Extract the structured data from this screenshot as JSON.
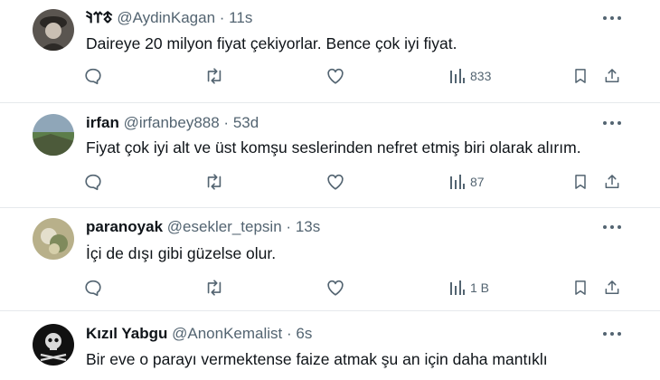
{
  "colors": {
    "text": "#0f1419",
    "muted": "#536471",
    "divider": "#e6e9ec"
  },
  "tweets": [
    {
      "name": "𐱃𐰼𐰚",
      "handle": "@AydinKagan",
      "sep": "·",
      "time": "11s",
      "text": "Daireye 20 milyon fiyat çekiyorlar. Bence çok iyi fiyat.",
      "views": "833"
    },
    {
      "name": "irfan",
      "handle": "@irfanbey888",
      "sep": "·",
      "time": "53d",
      "text": "Fiyat çok iyi alt ve üst komşu seslerinden nefret etmiş biri olarak alırım.",
      "views": "87"
    },
    {
      "name": "paranoyak",
      "handle": "@esekler_tepsin",
      "sep": "·",
      "time": "13s",
      "text": "İçi de dışı gibi güzelse olur.",
      "views": "1 B"
    },
    {
      "name": "Kızıl Yabgu",
      "handle": "@AnonKemalist",
      "sep": "·",
      "time": "6s",
      "text": "Bir eve o parayı vermektense faize atmak şu an için daha mantıklı"
    }
  ],
  "icons": {
    "more": "more-dots-icon",
    "reply": "reply-icon",
    "retweet": "retweet-icon",
    "like": "heart-icon",
    "views": "views-bar-chart-icon",
    "bookmark": "bookmark-icon",
    "share": "share-icon"
  }
}
